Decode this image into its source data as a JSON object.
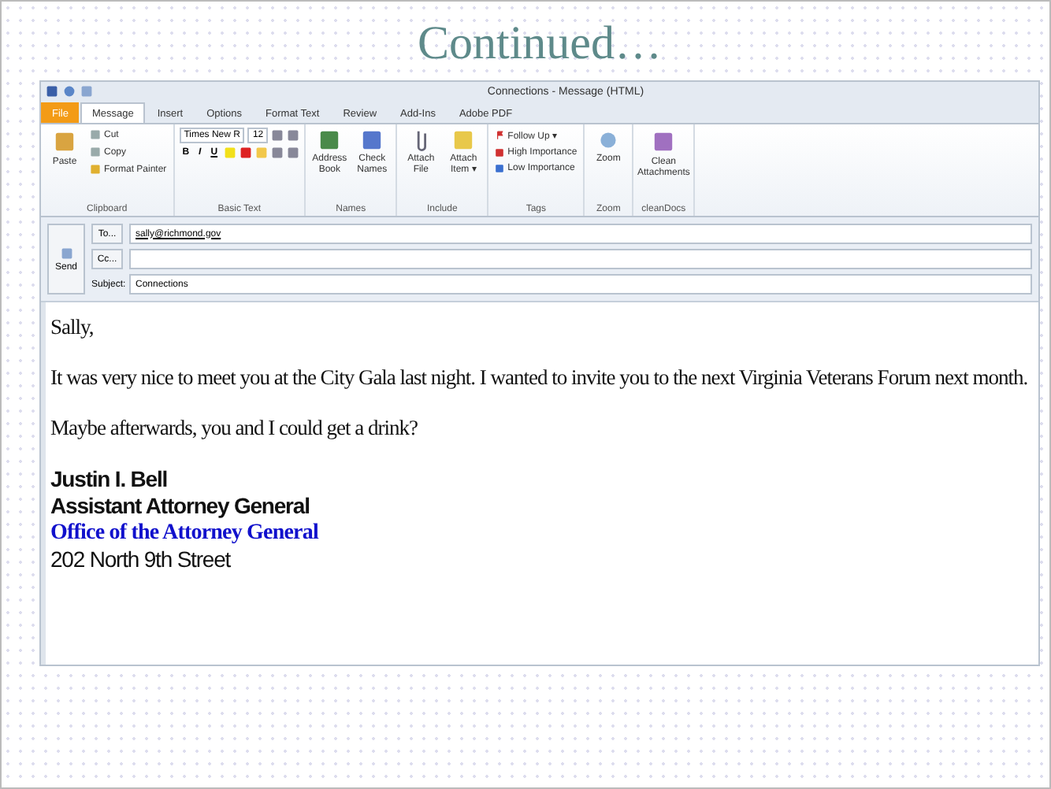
{
  "slide_title": "Continued…",
  "window": {
    "title": "Connections - Message (HTML)"
  },
  "tabs": [
    {
      "label": "File",
      "kind": "file",
      "selected": false
    },
    {
      "label": "Message",
      "kind": "tab",
      "selected": true
    },
    {
      "label": "Insert",
      "kind": "tab",
      "selected": false
    },
    {
      "label": "Options",
      "kind": "tab",
      "selected": false
    },
    {
      "label": "Format Text",
      "kind": "tab",
      "selected": false
    },
    {
      "label": "Review",
      "kind": "tab",
      "selected": false
    },
    {
      "label": "Add-Ins",
      "kind": "tab",
      "selected": false
    },
    {
      "label": "Adobe PDF",
      "kind": "tab",
      "selected": false
    }
  ],
  "ribbon": {
    "clipboard": {
      "label": "Clipboard",
      "paste": "Paste",
      "items": [
        "Cut",
        "Copy",
        "Format Painter"
      ]
    },
    "basic_text": {
      "label": "Basic Text",
      "font": "Times New R",
      "size": "12",
      "format_buttons": [
        "B",
        "I",
        "U"
      ]
    },
    "names": {
      "label": "Names",
      "buttons": [
        "Address Book",
        "Check Names"
      ]
    },
    "include": {
      "label": "Include",
      "buttons": [
        "Attach File",
        "Attach Item ▾"
      ]
    },
    "tags": {
      "label": "Tags",
      "items": [
        "Follow Up ▾",
        "High Importance",
        "Low Importance"
      ]
    },
    "zoom": {
      "label": "Zoom",
      "button": "Zoom"
    },
    "cleandocs": {
      "label": "cleanDocs",
      "button": "Clean Attachments"
    }
  },
  "compose": {
    "send": "Send",
    "fields": [
      {
        "label": "To...",
        "kind": "button",
        "value": "sally@richmond.gov"
      },
      {
        "label": "Cc...",
        "kind": "button"
      },
      {
        "label": "Subject:",
        "kind": "label",
        "value": "Connections"
      }
    ]
  },
  "body": {
    "paragraphs": [
      "Sally,",
      "It was very nice to meet you at the City Gala last night.  I wanted to invite you to the next Virginia Veterans Forum next month.",
      "Maybe afterwards, you and I could get a drink?"
    ],
    "signature": [
      {
        "text": "Justin I. Bell",
        "kind": "bold"
      },
      {
        "text": "Assistant Attorney General",
        "kind": "bold"
      },
      {
        "text": "Office of the Attorney General",
        "kind": "link"
      },
      {
        "text": "202 North 9th Street",
        "kind": "plain"
      }
    ]
  }
}
